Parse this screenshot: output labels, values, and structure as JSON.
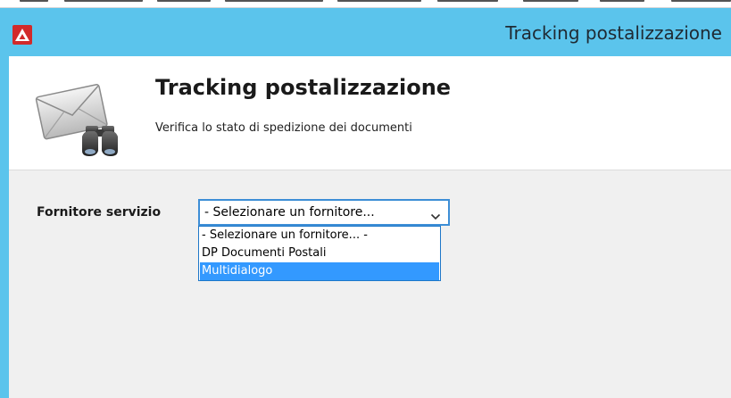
{
  "window": {
    "title": "Tracking postalizzazione",
    "accent_color": "#5bc4ec",
    "app_icon": "warning-triangle-icon"
  },
  "header": {
    "title": "Tracking postalizzazione",
    "subtitle": "Verifica lo stato di spedizione dei documenti",
    "icon": "envelope-binoculars-icon"
  },
  "form": {
    "provider_label": "Fornitore servizio",
    "provider_select": {
      "value": "- Selezionare un fornitore...",
      "expanded": true,
      "options": [
        {
          "label": "- Selezionare un fornitore... -",
          "selected": false
        },
        {
          "label": "DP Documenti Postali",
          "selected": false
        },
        {
          "label": "Multidialogo",
          "selected": true
        }
      ],
      "highlight_color": "#3399ff"
    }
  }
}
